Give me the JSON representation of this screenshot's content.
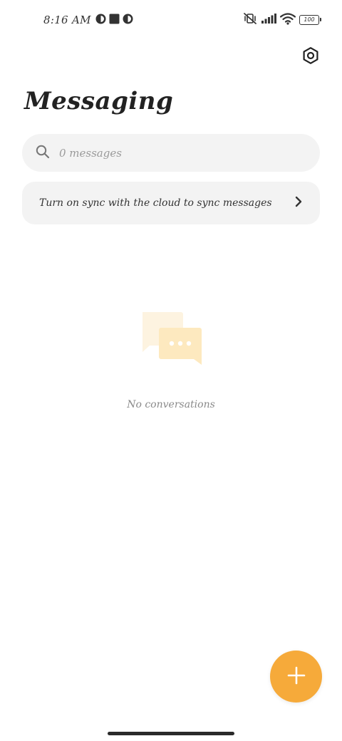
{
  "status_bar": {
    "time": "8:16 AM",
    "battery": "100"
  },
  "header": {
    "title": "Messaging"
  },
  "search": {
    "placeholder": "0 messages"
  },
  "sync_banner": {
    "text": "Turn on sync with the cloud to sync messages"
  },
  "empty_state": {
    "label": "No conversations"
  },
  "colors": {
    "accent": "#f6aa3a",
    "card_background": "#f3f3f3",
    "illustration": "#fde9bf"
  },
  "icons": {
    "settings": "gear-icon",
    "search": "search-icon",
    "chevron": "chevron-right-icon",
    "fab": "plus-icon",
    "empty": "chat-bubbles-icon"
  }
}
